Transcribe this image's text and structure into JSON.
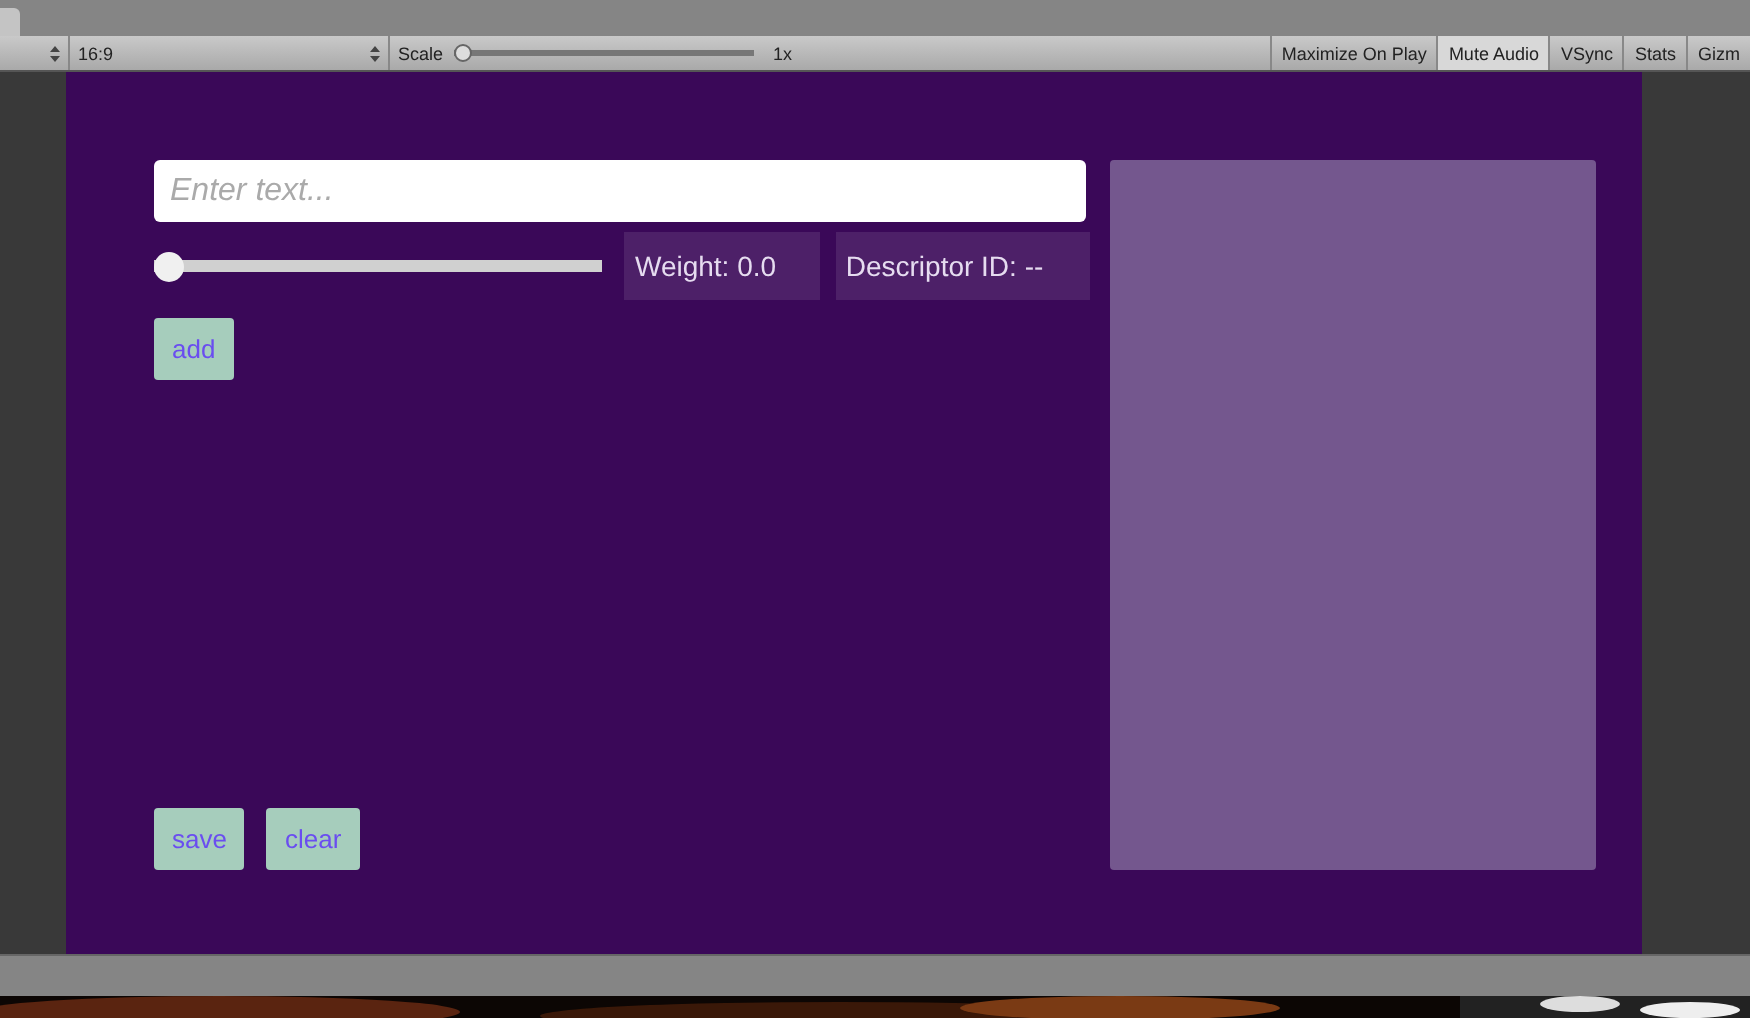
{
  "toolbar": {
    "aspect": "16:9",
    "scale": {
      "label": "Scale",
      "level": 0,
      "reading": "1x"
    },
    "toggles": [
      {
        "label": "Maximize On Play",
        "selected": false
      },
      {
        "label": "Mute Audio",
        "selected": true
      },
      {
        "label": "VSync",
        "selected": false
      },
      {
        "label": "Stats",
        "selected": false
      },
      {
        "label": "Gizm",
        "selected": false
      }
    ]
  },
  "form": {
    "input": {
      "placeholder": "Enter text..."
    },
    "weight_slider": {
      "level": 0
    },
    "weight": "Weight: 0.0",
    "descriptor": "Descriptor ID: --",
    "add": "add",
    "save": "save",
    "clear": "clear"
  }
}
